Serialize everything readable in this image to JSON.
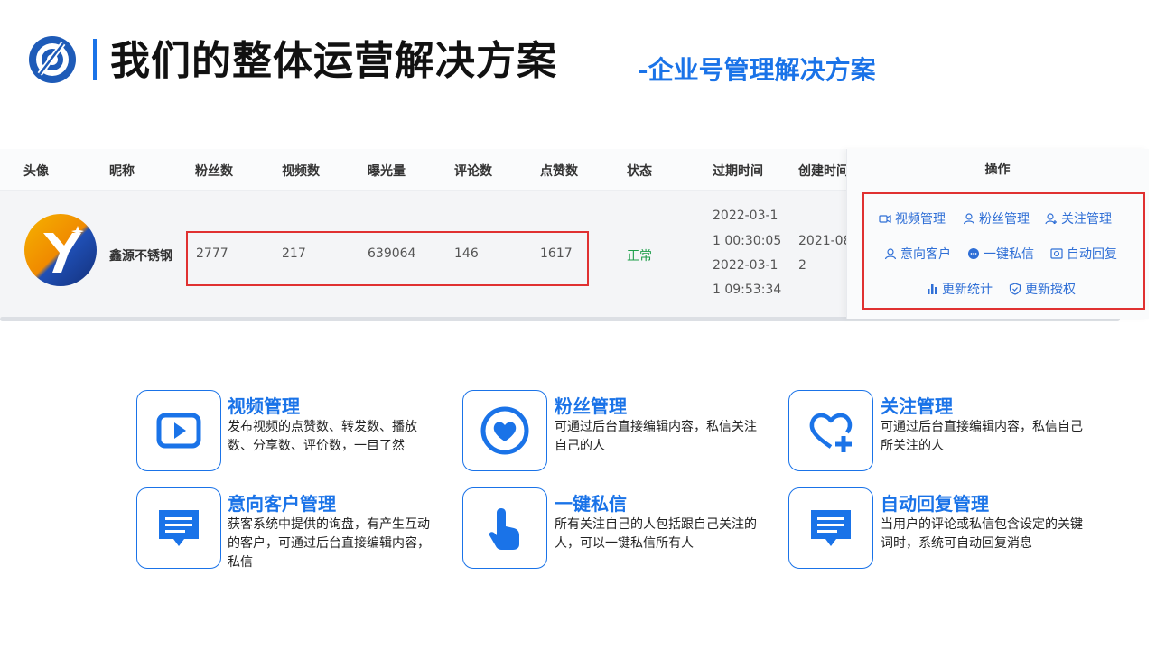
{
  "header": {
    "title": "我们的整体运营解决方案",
    "subtitle": "-企业号管理解决方案"
  },
  "table": {
    "columns": [
      "头像",
      "昵称",
      "粉丝数",
      "视频数",
      "曝光量",
      "评论数",
      "点赞数",
      "状态",
      "过期时间",
      "创建时间",
      "操作"
    ],
    "row": {
      "nickname": "鑫源不锈钢",
      "fans": "2777",
      "videos": "217",
      "exposure": "639064",
      "comments": "146",
      "likes": "1617",
      "status": "正常",
      "expire_line1": "2022-03-1",
      "expire_line2": "1 00:30:05",
      "expire_line3": "2022-03-1",
      "expire_line4": "1 09:53:34",
      "created_line1": "2021-08",
      "created_line2": "2"
    },
    "operations": [
      "视频管理",
      "粉丝管理",
      "关注管理",
      "意向客户",
      "一键私信",
      "自动回复",
      "更新统计",
      "更新授权"
    ]
  },
  "features": [
    {
      "title": "视频管理",
      "desc": "发布视频的点赞数、转发数、播放数、分享数、评价数，一目了然",
      "icon": "video-play-icon"
    },
    {
      "title": "粉丝管理",
      "desc": "可通过后台直接编辑内容，私信关注自己的人",
      "icon": "heart-icon"
    },
    {
      "title": "关注管理",
      "desc": "可通过后台直接编辑内容，私信自己所关注的人",
      "icon": "heart-plus-icon"
    },
    {
      "title": "意向客户管理",
      "desc": "获客系统中提供的询盘，有产生互动的客户，可通过后台直接编辑内容，私信",
      "icon": "message-icon"
    },
    {
      "title": "一键私信",
      "desc": "所有关注自己的人包括跟自己关注的人，可以一键私信所有人",
      "icon": "hand-tap-icon"
    },
    {
      "title": "自动回复管理",
      "desc": "当用户的评论或私信包含设定的关键词时，系统可自动回复消息",
      "icon": "message-icon"
    }
  ],
  "colors": {
    "accent": "#1a73e8",
    "highlight_box": "#e03131",
    "status_ok": "#1e9e4a",
    "link": "#2f6fd6"
  }
}
